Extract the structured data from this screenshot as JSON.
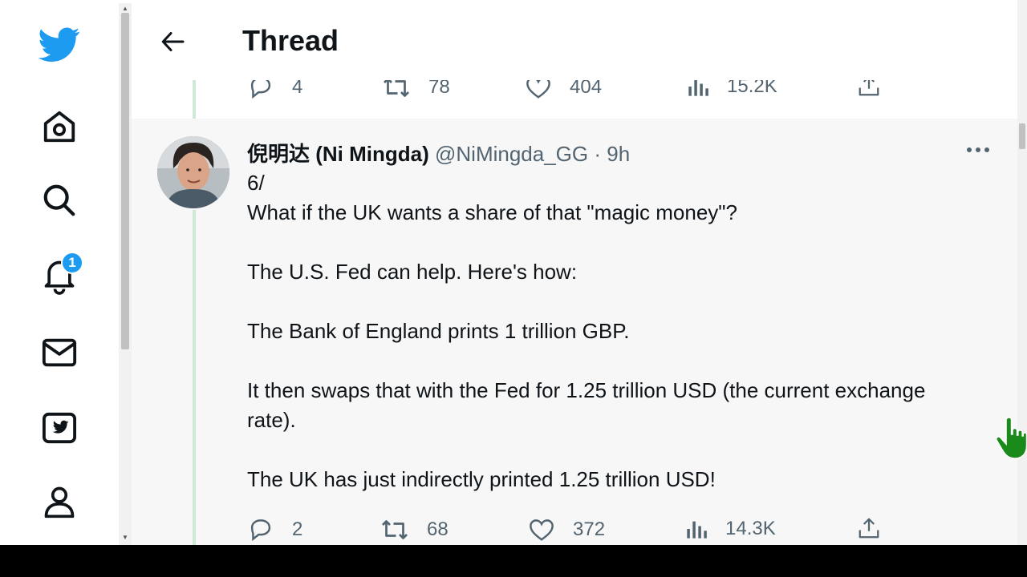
{
  "header": {
    "title": "Thread"
  },
  "nav": {
    "items": [
      {
        "name": "twitter-logo-icon"
      },
      {
        "name": "home-icon"
      },
      {
        "name": "search-icon"
      },
      {
        "name": "notifications-icon"
      },
      {
        "name": "messages-icon"
      },
      {
        "name": "twitter-blue-icon"
      },
      {
        "name": "profile-icon"
      }
    ],
    "notification_count": "1"
  },
  "previous_tweet": {
    "replies": "4",
    "retweets": "78",
    "likes": "404",
    "views": "15.2K"
  },
  "tweet": {
    "author_name": "倪明达 (Ni Mingda)",
    "handle_time": "@NiMingda_GG · 9h",
    "text": "6/\nWhat if the UK wants a share of that \"magic money\"?\n\nThe U.S. Fed can help. Here's how:\n\nThe Bank of England prints 1 trillion GBP.\n\nIt then swaps that with the Fed for 1.25 trillion USD (the current exchange rate).\n\nThe UK has just indirectly printed 1.25 trillion USD!",
    "replies": "2",
    "retweets": "68",
    "likes": "372",
    "views": "14.3K"
  },
  "colors": {
    "brand": "#1d9bf0",
    "text": "#0f1419",
    "muted": "#536471",
    "thread_line": "#cfe8d8"
  }
}
